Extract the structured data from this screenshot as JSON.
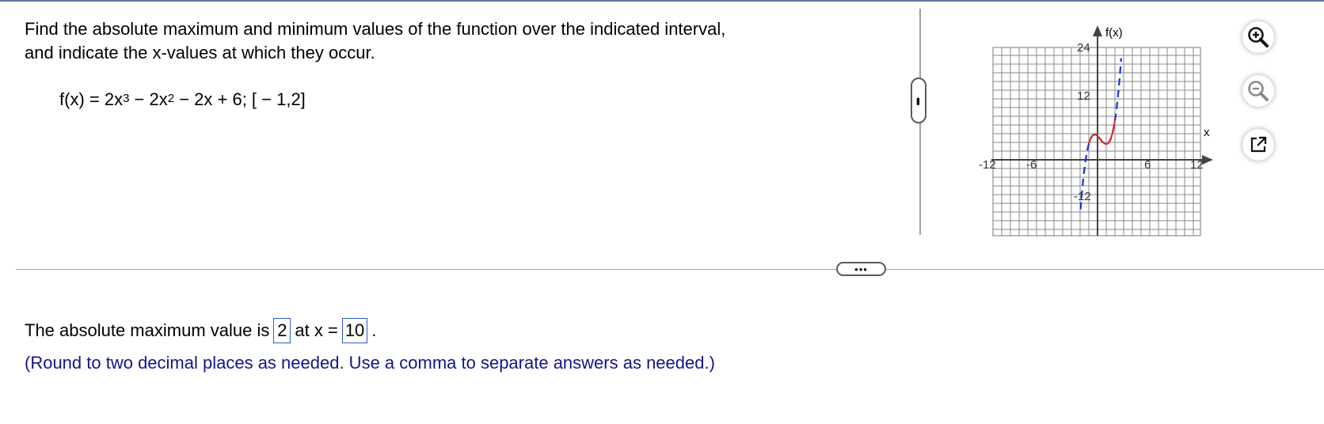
{
  "question": {
    "line1": "Find the absolute maximum and minimum values of the function over the indicated interval,",
    "line2": "and indicate the x-values at which they occur.",
    "formula_prefix": "f(x) = 2x",
    "exp1": "3",
    "formula_mid": " − 2x",
    "exp2": "2",
    "formula_suffix": " − 2x + 6; [ − 1,2]"
  },
  "graph": {
    "y_axis_label": "f(x)",
    "x_axis_label": "x",
    "x_ticks": [
      "-12",
      "-6",
      "6",
      "12"
    ],
    "y_ticks": [
      "24",
      "12",
      "-12"
    ],
    "curve_color": "#d9261c",
    "dashed_color": "#1a2fd6"
  },
  "tools": {
    "zoom_in": "zoom-in-icon",
    "zoom_out": "zoom-out-icon",
    "popout": "popout-icon"
  },
  "answer": {
    "prefix": "The absolute maximum value is",
    "max_value": "2",
    "mid": "at x =",
    "x_value": "10",
    "suffix": "."
  },
  "hint": "(Round to two decimal places as needed. Use a comma to separate answers as needed.)"
}
